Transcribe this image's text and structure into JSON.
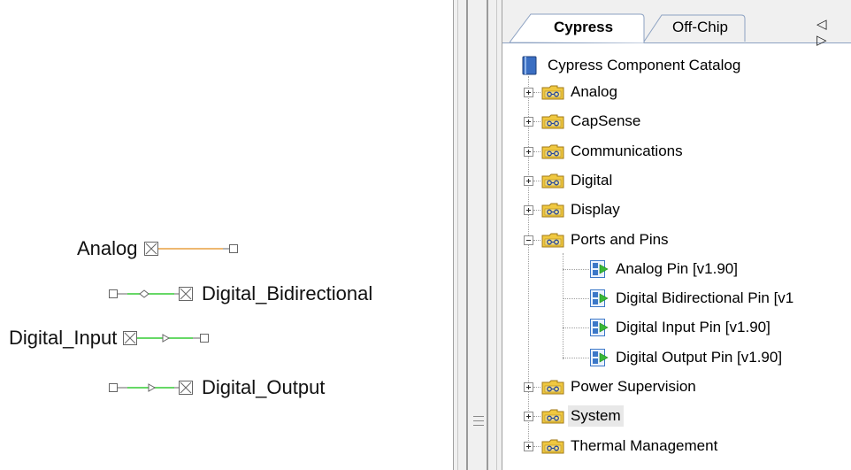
{
  "schematic": {
    "pins": [
      {
        "label": "Analog",
        "kind": "analog"
      },
      {
        "label": "Digital_Bidirectional",
        "kind": "bidirectional"
      },
      {
        "label": "Digital_Input",
        "kind": "input"
      },
      {
        "label": "Digital_Output",
        "kind": "output"
      }
    ]
  },
  "catalog": {
    "tabs": [
      {
        "label": "Cypress",
        "active": true
      },
      {
        "label": "Off-Chip",
        "active": false
      }
    ],
    "tab_nav": "◁ ▷",
    "root": {
      "label": "Cypress Component Catalog",
      "icon": "catalog-book-icon"
    },
    "categories": [
      {
        "label": "Analog",
        "expanded": false,
        "icon": "folder-component-icon"
      },
      {
        "label": "CapSense",
        "expanded": false,
        "icon": "folder-component-icon"
      },
      {
        "label": "Communications",
        "expanded": false,
        "icon": "folder-component-icon"
      },
      {
        "label": "Digital",
        "expanded": false,
        "icon": "folder-component-icon"
      },
      {
        "label": "Display",
        "expanded": false,
        "icon": "folder-component-icon"
      },
      {
        "label": "Ports and Pins",
        "expanded": true,
        "icon": "folder-component-icon",
        "children": [
          {
            "label": "Analog Pin [v1.90]",
            "icon": "pin-component-icon"
          },
          {
            "label": "Digital Bidirectional Pin [v1",
            "icon": "pin-component-icon"
          },
          {
            "label": "Digital Input Pin [v1.90]",
            "icon": "pin-component-icon"
          },
          {
            "label": "Digital Output Pin [v1.90]",
            "icon": "pin-component-icon"
          }
        ]
      },
      {
        "label": "Power Supervision",
        "expanded": false,
        "icon": "folder-component-icon"
      },
      {
        "label": "System",
        "expanded": false,
        "selected": true,
        "icon": "folder-component-icon"
      },
      {
        "label": "Thermal Management",
        "expanded": false,
        "icon": "folder-component-icon"
      }
    ]
  },
  "colors": {
    "analog_wire": "#e8a040",
    "digital_wire": "#33cc33",
    "tab_border": "#8da2c2",
    "folder_fill": "#f0c840",
    "pin_icon_blue": "#3c78c8",
    "pin_icon_arrow": "#38b838"
  }
}
